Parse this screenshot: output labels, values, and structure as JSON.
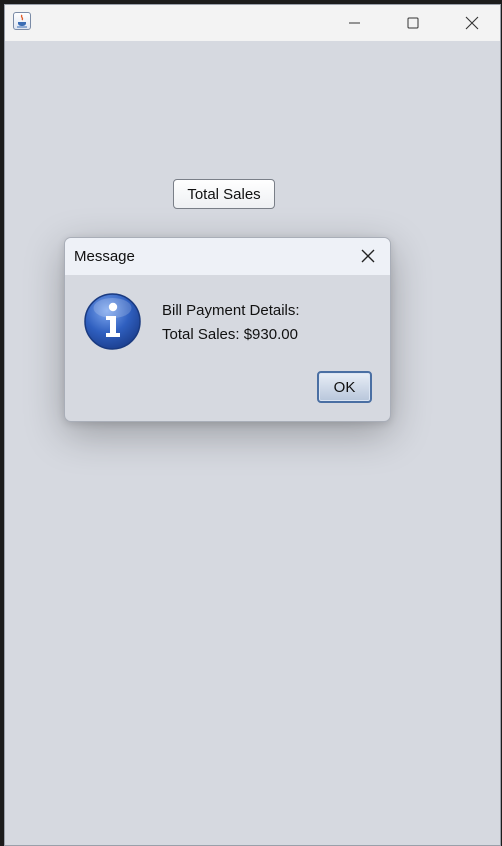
{
  "window": {
    "app_icon": "java-icon",
    "controls": {
      "minimize_icon": "minimize-icon",
      "maximize_icon": "maximize-icon",
      "close_icon": "close-icon"
    }
  },
  "main": {
    "total_sales_label": "Total Sales"
  },
  "dialog": {
    "title": "Message",
    "close_icon": "close-icon",
    "message_icon": "information-icon",
    "lines": [
      "Bill Payment Details:",
      "Total Sales: $930.00"
    ],
    "ok_label": "OK"
  },
  "colors": {
    "window_background": "#d6d9e0",
    "titlebar_background": "#f3f3f3",
    "dialog_titlebar_background": "#eef1f7",
    "info_icon_blue": "#2f5fbf",
    "ok_button_border": "#4a6fa3"
  }
}
